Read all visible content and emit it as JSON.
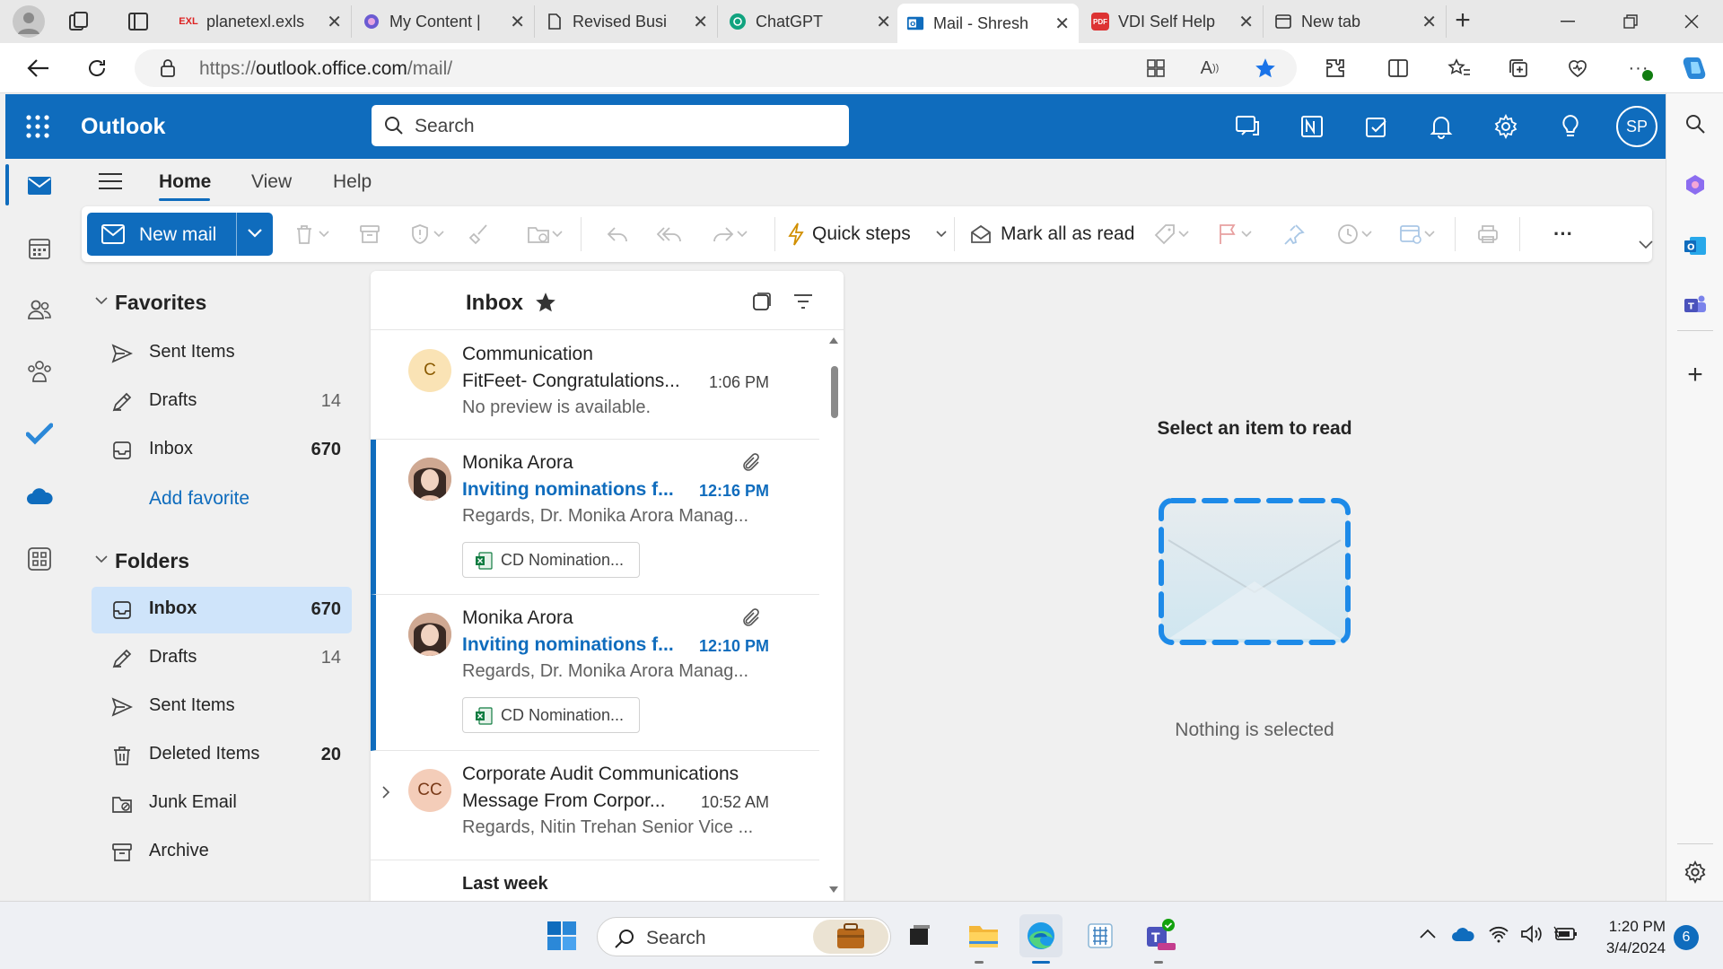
{
  "browser": {
    "tabs": [
      {
        "title": "planetexl.exls",
        "favicon": "exl-favicon",
        "badge": "EXL"
      },
      {
        "title": "My Content |",
        "favicon": "copilot-favicon"
      },
      {
        "title": "Revised Busi",
        "favicon": "document-favicon"
      },
      {
        "title": "ChatGPT",
        "favicon": "chatgpt-favicon"
      },
      {
        "title": "Mail - Shresh",
        "favicon": "outlook-favicon",
        "active": true
      },
      {
        "title": "VDI Self Help",
        "favicon": "pdf-favicon",
        "badge": "PDF"
      },
      {
        "title": "New tab",
        "favicon": "newtab-favicon"
      }
    ],
    "url_prefix": "https://",
    "url_host": "outlook.office.com",
    "url_path": "/mail/"
  },
  "outlook": {
    "brand": "Outlook",
    "search_placeholder": "Search",
    "avatar_initials": "SP",
    "ribbon_tabs": [
      "Home",
      "View",
      "Help"
    ],
    "new_mail_label": "New mail",
    "quick_steps_label": "Quick steps",
    "mark_all_read_label": "Mark all as read"
  },
  "folders": {
    "favorites_title": "Favorites",
    "favorites": [
      {
        "name": "Sent Items",
        "count": "",
        "icon": "send-icon"
      },
      {
        "name": "Drafts",
        "count": "14",
        "icon": "pencil-icon"
      },
      {
        "name": "Inbox",
        "count": "670",
        "icon": "inbox-icon",
        "bold": true
      }
    ],
    "add_favorite": "Add favorite",
    "folders_title": "Folders",
    "folders": [
      {
        "name": "Inbox",
        "count": "670",
        "icon": "inbox-icon",
        "bold": true,
        "selected": true
      },
      {
        "name": "Drafts",
        "count": "14",
        "icon": "pencil-icon"
      },
      {
        "name": "Sent Items",
        "count": "",
        "icon": "send-icon"
      },
      {
        "name": "Deleted Items",
        "count": "20",
        "icon": "trash-icon",
        "bold": true
      },
      {
        "name": "Junk Email",
        "count": "",
        "icon": "junk-icon"
      },
      {
        "name": "Archive",
        "count": "",
        "icon": "archive-icon"
      }
    ]
  },
  "message_list": {
    "title": "Inbox",
    "messages": [
      {
        "initials": "C",
        "from": "Communication",
        "subject": "FitFeet- Congratulations...",
        "time": "1:06 PM",
        "preview": "No preview is available.",
        "unread": false
      },
      {
        "initials": "",
        "from": "Monika Arora",
        "subject": "Inviting nominations f...",
        "time": "12:16 PM",
        "preview": "Regards, Dr. Monika Arora Manag...",
        "unread": true,
        "attachment": "CD Nomination..."
      },
      {
        "initials": "",
        "from": "Monika Arora",
        "subject": "Inviting nominations f...",
        "time": "12:10 PM",
        "preview": "Regards, Dr. Monika Arora Manag...",
        "unread": true,
        "attachment": "CD Nomination..."
      },
      {
        "initials": "CC",
        "from": "Corporate Audit Communications",
        "subject": "Message From Corpor...",
        "time": "10:52 AM",
        "preview": "Regards, Nitin Trehan Senior Vice ...",
        "unread": false
      }
    ],
    "group_header": "Last week"
  },
  "reading_pane": {
    "prompt": "Select an item to read",
    "empty_text": "Nothing is selected"
  },
  "taskbar": {
    "search_placeholder": "Search",
    "time": "1:20 PM",
    "date": "3/4/2024",
    "notification_count": "6"
  },
  "colors": {
    "accent": "#0f6cbd",
    "selected_folder": "#cfe4fa"
  }
}
